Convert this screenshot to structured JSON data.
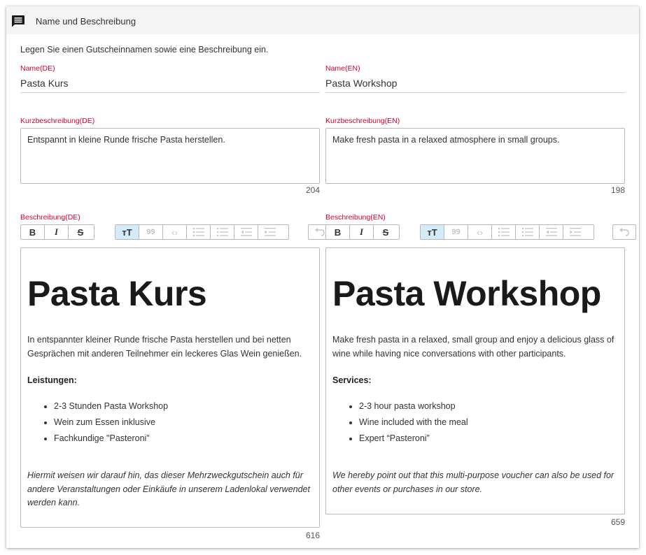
{
  "header": {
    "title": "Name und Beschreibung",
    "icon": "comment-icon"
  },
  "intro_text": "Legen Sie einen Gutscheinnamen sowie eine Beschreibung ein.",
  "accent_color": "#d50032",
  "de": {
    "name_label": "Name(DE)",
    "name_value": "Pasta Kurs",
    "short_label": "Kurzbeschreibung(DE)",
    "short_value": "Entspannt in kleine Runde frische Pasta herstellen.",
    "short_count": "204",
    "desc_label": "Beschreibung(DE)",
    "desc_count": "616",
    "content": {
      "heading": "Pasta Kurs",
      "paragraph": "In entspannter kleiner Runde frische Pasta herstellen und bei netten Gesprächen mit anderen Teilnehmer ein leckeres Glas Wein genießen.",
      "services_title": "Leistungen:",
      "services": [
        "2-3 Stunden Pasta Workshop",
        "Wein zum Essen inklusive",
        "Fachkundige \"Pasteroni\""
      ],
      "note": "Hiermit weisen wir darauf hin, das dieser Mehrzweckgutschein auch für andere Veranstaltungen oder Einkäufe in unserem Ladenlokal verwendet werden kann."
    }
  },
  "en": {
    "name_label": "Name(EN)",
    "name_value": "Pasta Workshop",
    "short_label": "Kurzbeschreibung(EN)",
    "short_value": "Make fresh pasta in a relaxed atmosphere in small groups.",
    "short_count": "198",
    "desc_label": "Beschreibung(EN)",
    "desc_count": "659",
    "content": {
      "heading": "Pasta Workshop",
      "paragraph": "Make fresh pasta in a relaxed, small group and enjoy a delicious glass of wine while having nice conversations with other participants.",
      "services_title": "Services:",
      "services": [
        "2-3 hour pasta workshop",
        "Wine included with the meal",
        "Expert “Pasteroni”"
      ],
      "note": "We hereby point out that this multi-purpose voucher can also be used for other events or purchases in our store."
    }
  },
  "toolbar": {
    "bold": "B",
    "italic": "I",
    "strike": "S",
    "heading": "тТ",
    "quote": "99",
    "code": "‹›",
    "icons": [
      "bold-icon",
      "italic-icon",
      "strikethrough-icon",
      "heading-icon",
      "quote-icon",
      "code-icon",
      "bullet-list-icon",
      "numbered-list-icon",
      "outdent-icon",
      "indent-icon",
      "undo-icon"
    ]
  }
}
